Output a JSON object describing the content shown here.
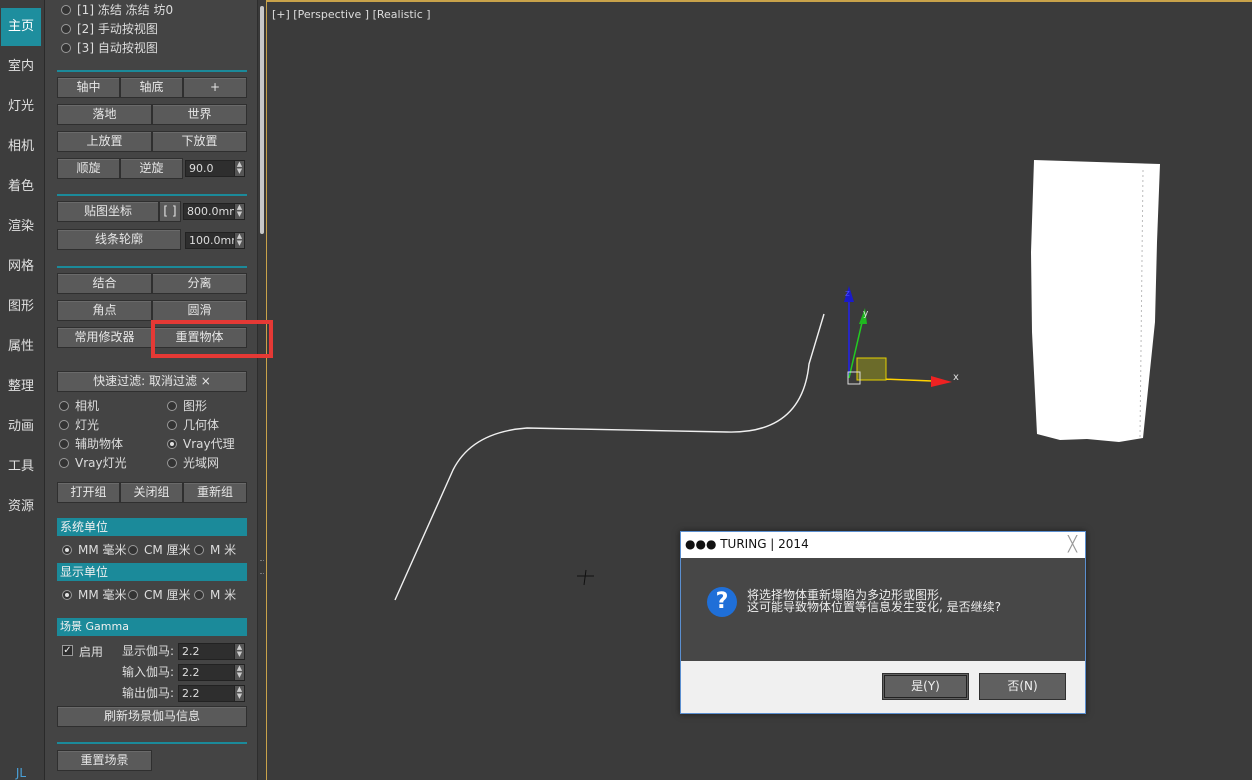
{
  "tabs": [
    {
      "label": "主页",
      "active": true
    },
    {
      "label": "室内"
    },
    {
      "label": "灯光"
    },
    {
      "label": "相机"
    },
    {
      "label": "着色"
    },
    {
      "label": "渲染"
    },
    {
      "label": "网格"
    },
    {
      "label": "图形"
    },
    {
      "label": "属性"
    },
    {
      "label": "整理"
    },
    {
      "label": "动画"
    },
    {
      "label": "工具"
    },
    {
      "label": "资源"
    }
  ],
  "tabs_bottom_glyph": "JL",
  "view_options": {
    "opt1": "[1] 冻结 冻结 坊0",
    "opt2": "[2] 手动按视图",
    "opt3": "[3] 自动按视图"
  },
  "pivot": {
    "center": "轴中",
    "bottom": "轴底",
    "plus": "+",
    "ground": "落地",
    "world": "世界",
    "place_up": "上放置",
    "place_down": "下放置",
    "rotate_cw": "顺旋",
    "rotate_ccw": "逆旋",
    "rotate_angle": "90.0"
  },
  "mapping": {
    "map_coords": "贴图坐标",
    "bracket": "[ ]",
    "map_size": "800.0mm",
    "spline_outline": "线条轮廓",
    "outline_size": "100.0mm"
  },
  "modify": {
    "attach": "结合",
    "detach": "分离",
    "corner": "角点",
    "smooth": "圆滑",
    "common_modifiers": "常用修改器",
    "reset_object": "重置物体"
  },
  "filter": {
    "quick_filter": "快速过滤:  取消过滤 ×",
    "camera": "相机",
    "shape": "图形",
    "light": "灯光",
    "geometry": "几何体",
    "helper": "辅助物体",
    "vray_proxy": "Vray代理",
    "vray_light": "Vray灯光",
    "ies": "光域网"
  },
  "groups": {
    "open": "打开组",
    "close": "关闭组",
    "regroup": "重新组"
  },
  "system_units": {
    "header": "系统单位",
    "mm": "MM 毫米",
    "cm": "CM 厘米",
    "m": "M 米"
  },
  "display_units": {
    "header": "显示单位",
    "mm": "MM 毫米",
    "cm": "CM 厘米",
    "m": "M 米"
  },
  "gamma": {
    "header": "场景 Gamma",
    "enable": "启用",
    "display_label": "显示伽马:",
    "display_value": "2.2",
    "input_label": "输入伽马:",
    "input_value": "2.2",
    "output_label": "输出伽马:",
    "output_value": "2.2",
    "refresh": "刷新场景伽马信息"
  },
  "reset_scene": "重置场景",
  "viewport": {
    "label": "[+] [Perspective ] [Realistic ]",
    "axis_x": "x",
    "axis_y": "y",
    "axis_z": "z"
  },
  "dialog": {
    "title": "●●● TURING | 2014",
    "message_line1": "将选择物体重新塌陷为多边形或图形,",
    "message_line2": "这可能导致物体位置等信息发生变化, 是否继续?",
    "yes": "是(Y)",
    "no": "否(N)",
    "close_glyph": "╳",
    "icon_glyph": "?"
  },
  "colors": {
    "accent": "#1b8a9a",
    "highlight": "#e53935",
    "viewport_border": "#c8a24a"
  }
}
